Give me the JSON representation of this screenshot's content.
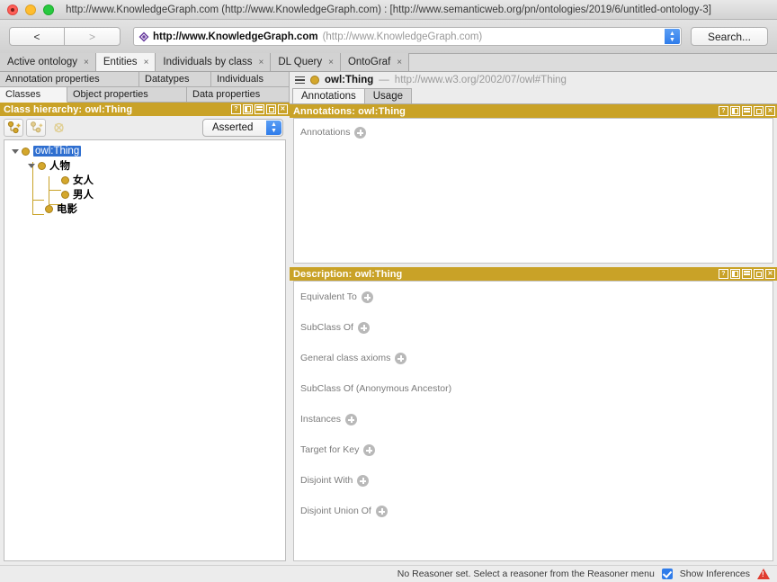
{
  "window": {
    "title": "http://www.KnowledgeGraph.com (http://www.KnowledgeGraph.com)  : [http://www.semanticweb.org/pn/ontologies/2019/6/untitled-ontology-3]",
    "traffic_lights": [
      "close-button",
      "minimize-button",
      "zoom-button"
    ]
  },
  "navbar": {
    "back_label": "<",
    "forward_label": ">",
    "url_icon": "ontology-diamond-icon",
    "url_main": "http://www.KnowledgeGraph.com",
    "url_secondary": "(http://www.KnowledgeGraph.com)",
    "search_label": "Search..."
  },
  "tabs": [
    {
      "label": "Active ontology",
      "close": "×",
      "active": false
    },
    {
      "label": "Entities",
      "close": "×",
      "active": true
    },
    {
      "label": "Individuals by class",
      "close": "×",
      "active": false
    },
    {
      "label": "DL Query",
      "close": "×",
      "active": false
    },
    {
      "label": "OntoGraf",
      "close": "×",
      "active": false
    }
  ],
  "left_panel": {
    "subtabs_row1": [
      {
        "label": "Annotation properties",
        "active": false
      },
      {
        "label": "Datatypes",
        "active": false
      },
      {
        "label": "Individuals",
        "active": false
      }
    ],
    "subtabs_row2": [
      {
        "label": "Classes",
        "active": true
      },
      {
        "label": "Object properties",
        "active": false
      },
      {
        "label": "Data properties",
        "active": false
      }
    ],
    "header": {
      "title": "Class hierarchy: owl:Thing",
      "buttons": [
        "help-icon",
        "split-pane-icon",
        "minimize-icon",
        "maximize-icon",
        "close-icon"
      ]
    },
    "toolbar": {
      "add_subclass": "add-subclass-icon",
      "add_sibling": "add-sibling-class-icon",
      "delete_class": "delete-class-icon",
      "reasoner_mode": "Asserted"
    },
    "tree": [
      {
        "label": "owl:Thing",
        "depth": 0,
        "selected": true,
        "expanded": true,
        "cjk": false
      },
      {
        "label": "人物",
        "depth": 1,
        "selected": false,
        "expanded": true,
        "cjk": true
      },
      {
        "label": "女人",
        "depth": 2,
        "selected": false,
        "expanded": false,
        "cjk": true
      },
      {
        "label": "男人",
        "depth": 2,
        "selected": false,
        "expanded": false,
        "cjk": true
      },
      {
        "label": "电影",
        "depth": 1,
        "selected": false,
        "expanded": false,
        "cjk": true
      }
    ]
  },
  "right_panel": {
    "entity": {
      "menu_icon": "hamburger-menu-icon",
      "type_icon": "class-dot-icon",
      "name": "owl:Thing",
      "dash": "—",
      "uri": "http://www.w3.org/2002/07/owl#Thing"
    },
    "tabs": [
      {
        "label": "Annotations",
        "active": true
      },
      {
        "label": "Usage",
        "active": false
      }
    ],
    "annotations_section": {
      "header": {
        "title": "Annotations: owl:Thing",
        "buttons": [
          "help-icon",
          "split-pane-icon",
          "minimize-icon",
          "maximize-icon",
          "close-icon"
        ]
      },
      "rows": [
        {
          "label": "Annotations",
          "has_add": true
        }
      ]
    },
    "description_section": {
      "header": {
        "title": "Description: owl:Thing",
        "buttons": [
          "help-icon",
          "split-pane-icon",
          "minimize-icon",
          "maximize-icon",
          "close-icon"
        ]
      },
      "rows": [
        {
          "label": "Equivalent To",
          "has_add": true
        },
        {
          "label": "SubClass Of",
          "has_add": true
        },
        {
          "label": "General class axioms",
          "has_add": true
        },
        {
          "label": "SubClass Of (Anonymous Ancestor)",
          "has_add": false
        },
        {
          "label": "Instances",
          "has_add": true
        },
        {
          "label": "Target for Key",
          "has_add": true
        },
        {
          "label": "Disjoint With",
          "has_add": true
        },
        {
          "label": "Disjoint Union Of",
          "has_add": true
        }
      ]
    }
  },
  "statusbar": {
    "message": "No Reasoner set. Select a reasoner from the Reasoner menu",
    "show_inferences_label": "Show Inferences",
    "show_inferences_checked": true,
    "warning_icon": "warning-triangle-icon"
  },
  "colors": {
    "panel_header_gold": "#c9a227",
    "selection_blue": "#2f6fd0",
    "class_dot": "#d4a72c",
    "warning_red": "#e03b2f"
  }
}
